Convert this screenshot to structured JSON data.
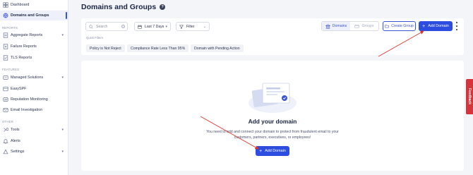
{
  "sidebar": {
    "items_top": [
      {
        "label": "Dashboard",
        "icon": "dashboard-icon"
      },
      {
        "label": "Domains and Groups",
        "icon": "domains-icon",
        "active": true
      }
    ],
    "section_reports": "REPORTS",
    "reports": [
      {
        "label": "Aggregate Reports",
        "icon": "aggregate-icon",
        "expandable": true
      },
      {
        "label": "Failure Reports",
        "icon": "failure-icon"
      },
      {
        "label": "TLS Reports",
        "icon": "tls-icon"
      }
    ],
    "section_features": "FEATURES",
    "features": [
      {
        "label": "Managed Solutions",
        "icon": "managed-icon",
        "expandable": true
      },
      {
        "label": "EasySPF",
        "icon": "easyspf-icon"
      },
      {
        "label": "Reputation Monitoring",
        "icon": "reputation-icon"
      },
      {
        "label": "Email Investigation",
        "icon": "investigation-icon"
      }
    ],
    "section_other": "OTHER",
    "other": [
      {
        "label": "Tools",
        "icon": "tools-icon",
        "expandable": true
      },
      {
        "label": "Alerts",
        "icon": "bell-icon"
      },
      {
        "label": "Settings",
        "icon": "settings-icon",
        "expandable": true
      }
    ]
  },
  "page": {
    "title": "Domains and Groups",
    "help": "?"
  },
  "filters": {
    "search_placeholder": "Search",
    "clear": "×",
    "date_range": "Last 7 Days",
    "filter_label": "Filter",
    "quick_filters_label": "Quick Filters",
    "quick_filters": [
      "Policy is Not Reject",
      "Compliance Rate Less Than 95%",
      "Domain with Pending Action"
    ]
  },
  "toolbar": {
    "view_domains": "Domains",
    "view_groups": "Groups",
    "create_group": "Create Group",
    "add_domain": "Add Domain"
  },
  "empty_state": {
    "title": "Add your domain",
    "description": "You need to add and connect your domain to protect from fraudulent email to your customers, partners, executives, or employees!",
    "button": "Add Domain"
  },
  "feedback": "Feedback",
  "colors": {
    "accent": "#2c4de0",
    "annotation_arrow": "#e0342f",
    "feedback": "#d4343b"
  }
}
